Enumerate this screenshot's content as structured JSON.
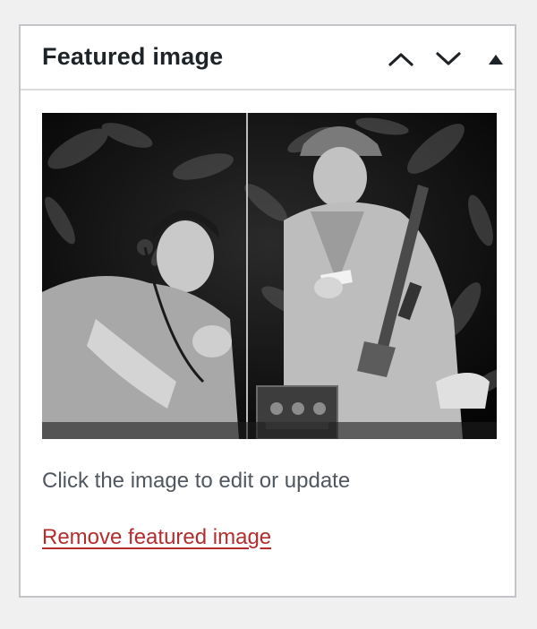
{
  "panel": {
    "title": "Featured image",
    "controls": [
      {
        "name": "move-up",
        "icon": "chevron-up-icon"
      },
      {
        "name": "move-down",
        "icon": "chevron-down-icon"
      },
      {
        "name": "toggle-panel",
        "icon": "triangle-up-icon"
      }
    ]
  },
  "image": {
    "alt": "Black and white photograph of two soldiers operating a field radio in the jungle"
  },
  "help_text": "Click the image to edit or update",
  "remove_link": "Remove featured image",
  "colors": {
    "title": "#1d2327",
    "help_text": "#50575e",
    "remove_link": "#b32d2e",
    "border": "#c3c4c7"
  }
}
